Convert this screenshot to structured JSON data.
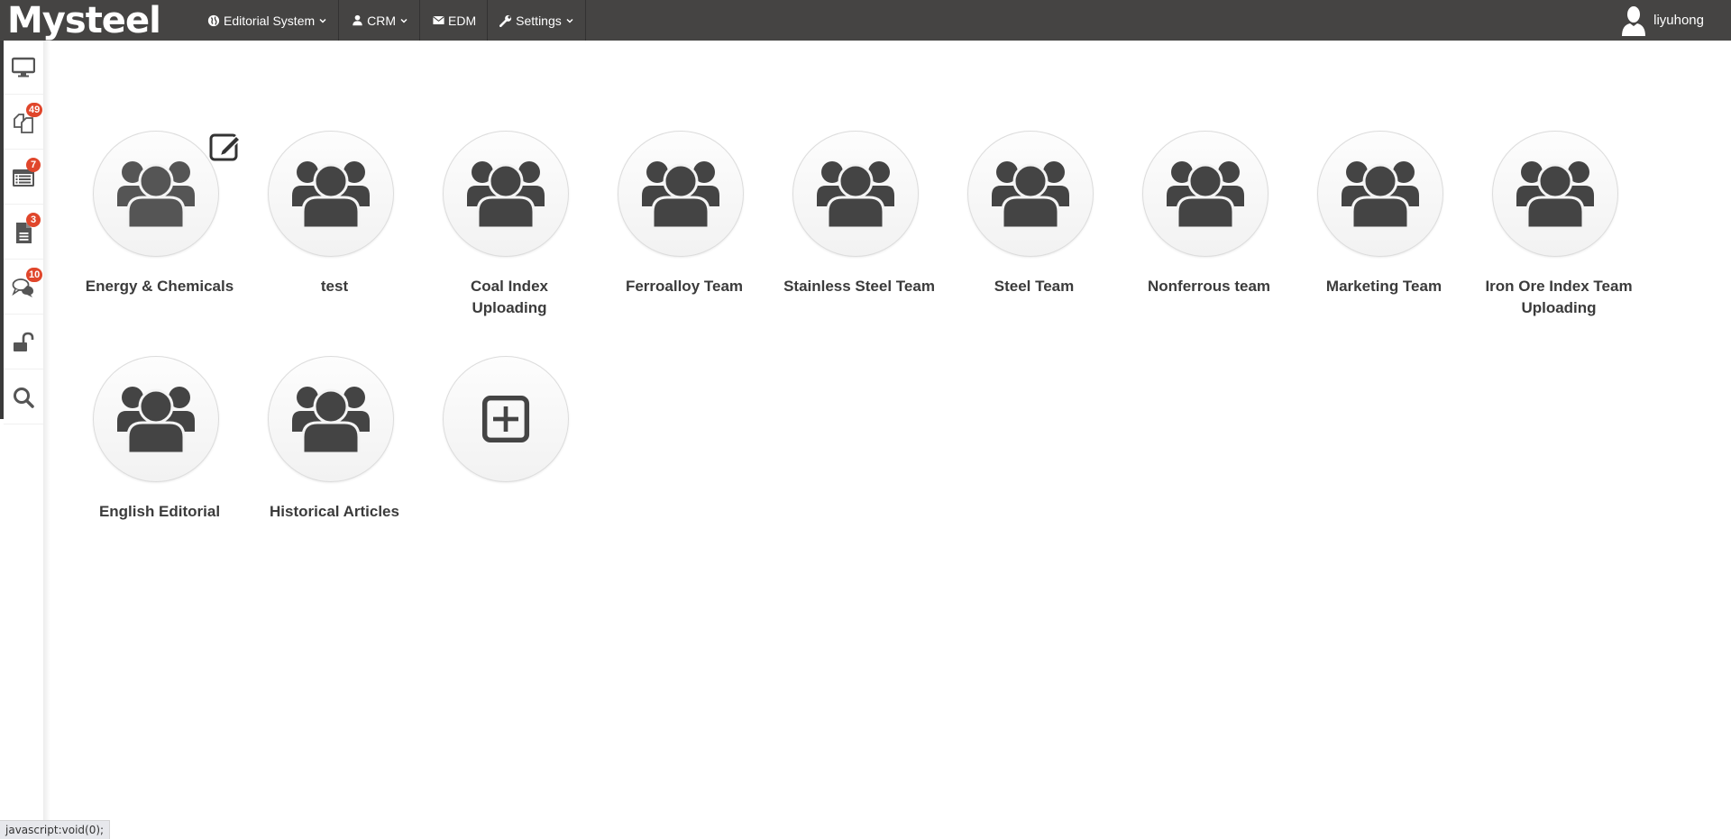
{
  "app": {
    "logo_text": "Mysteel",
    "colors": {
      "navbar_bg": "#454443",
      "badge": "#e0462b",
      "icon": "#444444",
      "label": "#3b3b3b"
    }
  },
  "navbar": {
    "items": [
      {
        "label": "Editorial System",
        "icon": "globe-icon",
        "has_dropdown": true
      },
      {
        "label": "CRM",
        "icon": "user-icon",
        "has_dropdown": true
      },
      {
        "label": "EDM",
        "icon": "envelope-icon",
        "has_dropdown": false
      },
      {
        "label": "Settings",
        "icon": "wrench-icon",
        "has_dropdown": true
      }
    ],
    "user": {
      "name": "liyuhong",
      "icon": "user-avatar-icon"
    }
  },
  "sidebar": {
    "items": [
      {
        "name": "desktop",
        "icon": "desktop-icon",
        "badge": null
      },
      {
        "name": "documents",
        "icon": "copy-icon",
        "badge": "49"
      },
      {
        "name": "list",
        "icon": "list-alt-icon",
        "badge": "7"
      },
      {
        "name": "file",
        "icon": "file-text-icon",
        "badge": "3"
      },
      {
        "name": "comments",
        "icon": "comments-icon",
        "badge": "10"
      },
      {
        "name": "unlock",
        "icon": "unlock-icon",
        "badge": null
      },
      {
        "name": "search",
        "icon": "search-icon",
        "badge": null
      }
    ]
  },
  "groups": [
    {
      "label": "Energy & Chemicals",
      "icon": "users-icon",
      "hovered": true
    },
    {
      "label": "test",
      "icon": "users-icon"
    },
    {
      "label": "Coal Index Uploading",
      "icon": "users-icon"
    },
    {
      "label": "Ferroalloy Team",
      "icon": "users-icon"
    },
    {
      "label": "Stainless Steel Team",
      "icon": "users-icon"
    },
    {
      "label": "Steel Team",
      "icon": "users-icon"
    },
    {
      "label": "Nonferrous team",
      "icon": "users-icon"
    },
    {
      "label": "Marketing Team",
      "icon": "users-icon"
    },
    {
      "label": "Iron Ore Index Team Uploading",
      "icon": "users-icon"
    },
    {
      "label": "English Editorial",
      "icon": "users-icon"
    },
    {
      "label": "Historical Articles",
      "icon": "users-icon"
    }
  ],
  "add_group": {
    "icon": "plus-square-icon"
  },
  "statusbar": {
    "text": "javascript:void(0);"
  }
}
